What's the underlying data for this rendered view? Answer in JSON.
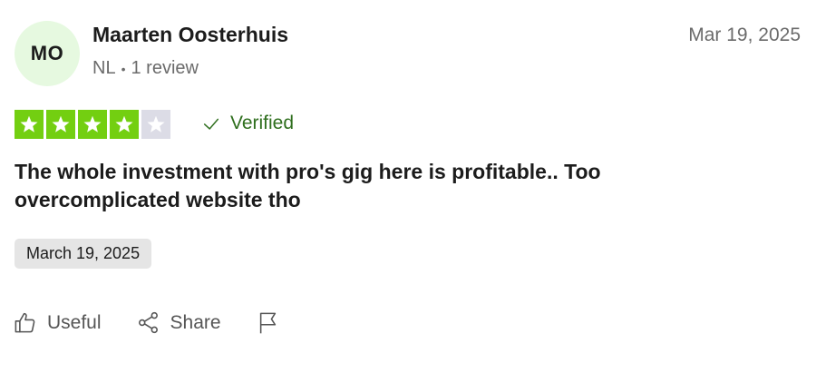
{
  "reviewer": {
    "initials": "MO",
    "name": "Maarten Oosterhuis",
    "country": "NL",
    "separator": "•",
    "review_count": "1 review"
  },
  "review": {
    "date_top": "Mar 19, 2025",
    "rating": 4,
    "rating_max": 5,
    "verified_label": "Verified",
    "title": "The whole investment with pro's gig here is profitable.. Too overcomplicated website tho",
    "experience_date": "March 19, 2025"
  },
  "actions": {
    "useful_label": "Useful",
    "share_label": "Share"
  },
  "icons": [
    "star-icon",
    "checkmark-icon",
    "thumbs-up-icon",
    "share-icon",
    "flag-icon"
  ],
  "colors": {
    "star_on": "#73cf11",
    "star_off": "#dcdce6",
    "avatar_bg": "#e6f9e0",
    "verified": "#2f6f1e",
    "badge_bg": "#e5e5e5"
  }
}
